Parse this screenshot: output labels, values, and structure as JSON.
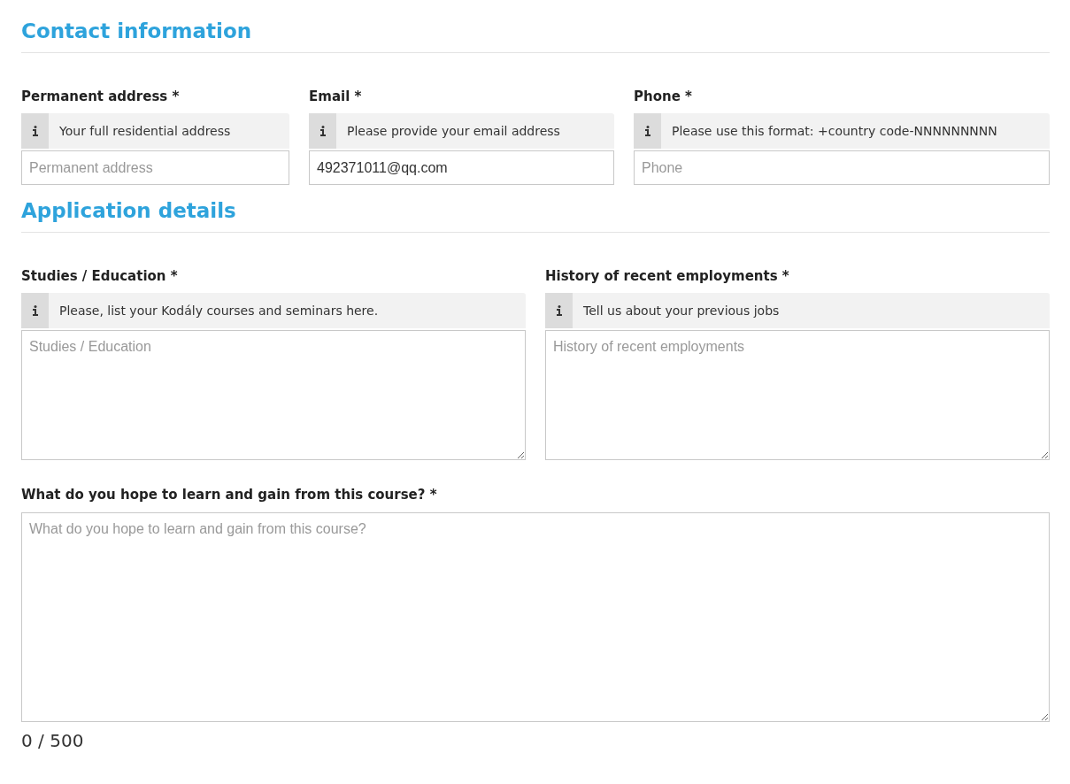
{
  "sections": [
    {
      "title": "Contact information",
      "fields": [
        {
          "kind": "input",
          "label": "Permanent address *",
          "hint": "Your full residential address",
          "placeholder": "Permanent address"
        },
        {
          "kind": "input",
          "label": "Email *",
          "hint": "Please provide your email address",
          "value": "492371011@qq.com"
        },
        {
          "kind": "input",
          "label": "Phone *",
          "hint": "Please use this format: +country code-NNNNNNNNN",
          "placeholder": "Phone"
        }
      ]
    },
    {
      "title": "Application details",
      "fields": [
        {
          "kind": "textarea",
          "label": "Studies / Education *",
          "hint": "Please, list your Kodály courses and seminars here.",
          "placeholder": "Studies / Education"
        },
        {
          "kind": "textarea",
          "label": "History of recent employments *",
          "hint": "Tell us about your previous jobs",
          "placeholder": "History of recent employments"
        }
      ]
    }
  ],
  "question": {
    "label": "What do you hope to learn and gain from this course? *",
    "placeholder": "What do you hope to learn and gain from this course?",
    "counter": "0 / 500"
  }
}
